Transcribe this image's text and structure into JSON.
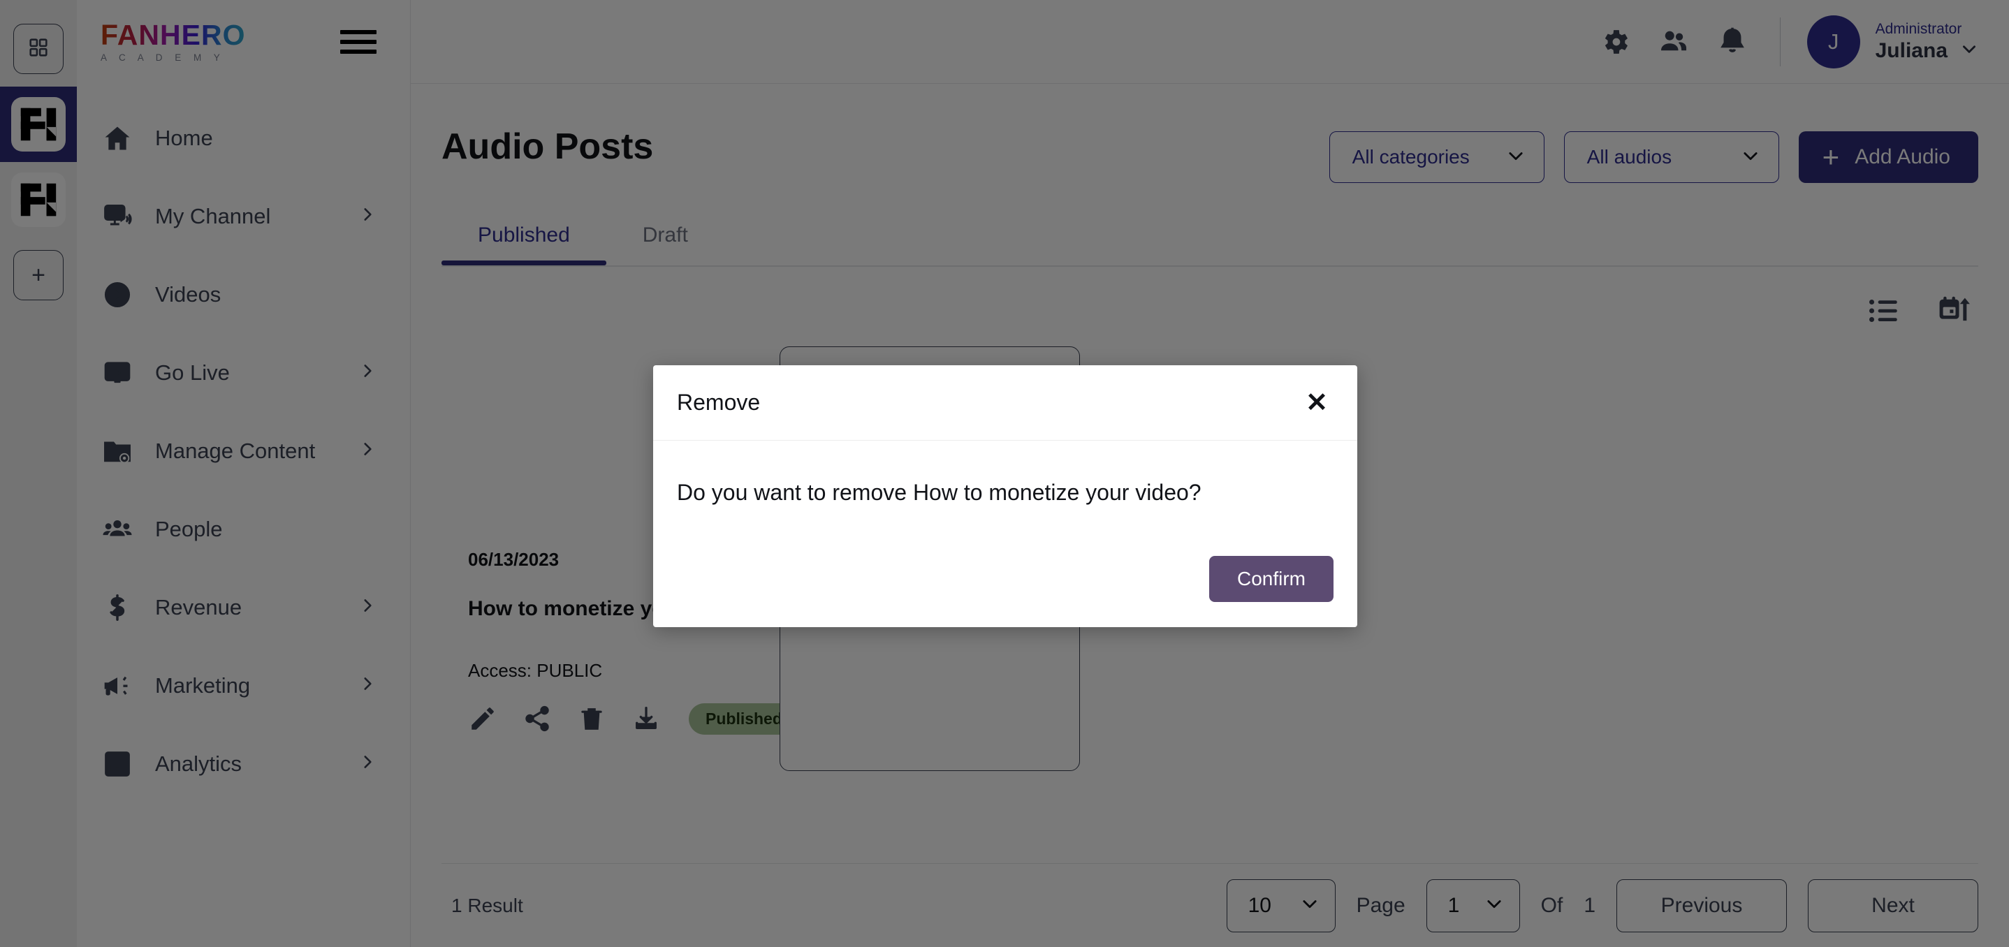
{
  "rail": {
    "items": [
      {
        "name": "apps-grid",
        "icon": "grid-icon",
        "active": false
      },
      {
        "name": "workspace-fanhero-academy",
        "icon": "fanhero-logo-icon",
        "active": true
      },
      {
        "name": "workspace-fanhero-secondary",
        "icon": "fanhero-logo-icon",
        "active": false
      },
      {
        "name": "add-workspace",
        "icon": "plus-icon",
        "active": false
      }
    ]
  },
  "sidebar": {
    "logo": {
      "word": "FANHERO",
      "sub": "A C A D E M Y"
    },
    "menu_toggle": "hamburger-icon",
    "items": [
      {
        "label": "Home",
        "icon": "home-icon",
        "chevron": false
      },
      {
        "label": "My Channel",
        "icon": "monitor-speaker-icon",
        "chevron": true
      },
      {
        "label": "Videos",
        "icon": "play-circle-icon",
        "chevron": false
      },
      {
        "label": "Go Live",
        "icon": "tv-play-icon",
        "chevron": true
      },
      {
        "label": "Manage Content",
        "icon": "folder-gear-icon",
        "chevron": true
      },
      {
        "label": "People",
        "icon": "people-icon",
        "chevron": false
      },
      {
        "label": "Revenue",
        "icon": "dollar-icon",
        "chevron": true
      },
      {
        "label": "Marketing",
        "icon": "megaphone-icon",
        "chevron": true
      },
      {
        "label": "Analytics",
        "icon": "bar-chart-icon",
        "chevron": true
      }
    ]
  },
  "topbar": {
    "icons": [
      {
        "name": "settings-gear-icon"
      },
      {
        "name": "people-icon"
      },
      {
        "name": "notifications-bell-icon"
      }
    ],
    "user": {
      "avatar_initial": "J",
      "role": "Administrator",
      "name": "Juliana",
      "caret": "chevron-down-icon"
    }
  },
  "main": {
    "title": "Audio Posts",
    "filters": [
      {
        "name": "all-categories",
        "label": "All categories"
      },
      {
        "name": "all-audios",
        "label": "All audios"
      }
    ],
    "add_button": {
      "label": "Add Audio",
      "plus": "+"
    },
    "tabs": [
      {
        "label": "Published",
        "active": true
      },
      {
        "label": "Draft",
        "active": false
      }
    ],
    "view_tools": [
      {
        "name": "list-view-icon"
      },
      {
        "name": "calendar-sort-ascending-icon"
      }
    ],
    "cards": [
      {
        "date": "06/13/2023",
        "name": "How to monetize your video",
        "access_label": "Access: PUBLIC",
        "status": "Published",
        "actions": [
          "edit-pencil-icon",
          "share-icon",
          "delete-trash-icon",
          "download-icon"
        ]
      },
      {
        "date": "",
        "name": "",
        "access_label": "",
        "status": "",
        "actions": []
      }
    ]
  },
  "footer": {
    "result_count": "1 Result",
    "page_size": "10",
    "page_label": "Page",
    "page_value": "1",
    "of_label": "Of",
    "total_pages": "1",
    "previous_label": "Previous",
    "next_label": "Next"
  },
  "modal": {
    "title": "Remove",
    "close_icon": "✕",
    "message": "Do you want to remove How to monetize your video?",
    "confirm_label": "Confirm"
  },
  "colors": {
    "brand_indigo": "#2e2d7a",
    "brand_indigo_text": "#2e2d8f",
    "ink": "#3b4252",
    "confirm_purple": "#5c4b72",
    "badge_green_bg": "#a8c29a",
    "badge_green_text": "#1d3010"
  }
}
